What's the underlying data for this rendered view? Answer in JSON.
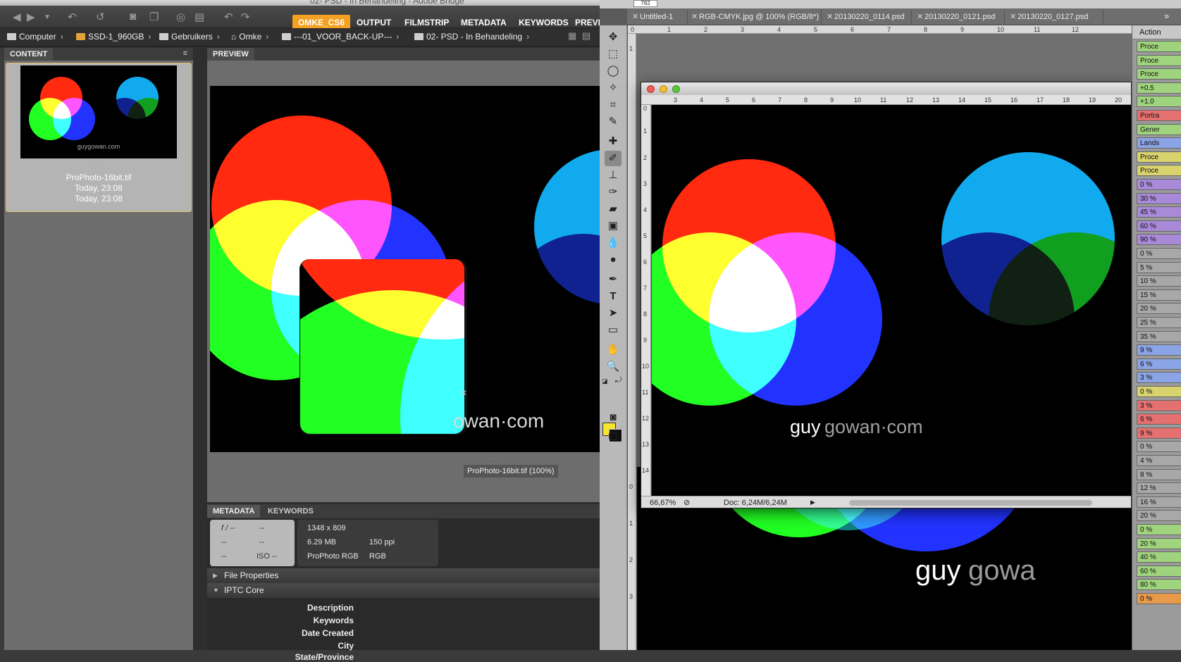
{
  "bridge": {
    "window_title": "02- PSD - In Behandeling - Adobe Bridge",
    "workspaces": [
      "OMKE_CS6",
      "OUTPUT",
      "FILMSTRIP",
      "METADATA",
      "KEYWORDS",
      "PREVI"
    ],
    "breadcrumbs": [
      "Computer",
      "SSD-1_960GB",
      "Gebruikers",
      "Omke",
      "---01_VOOR_BACK-UP---",
      "02- PSD - In Behandeling"
    ],
    "content_tab": "CONTENT",
    "preview_tab": "PREVIEW",
    "thumbnail": {
      "name": "ProPhoto-16bit.tif",
      "date_created": "Today, 23:08",
      "date_modified": "Today, 23:08",
      "logo": "guygowan.com"
    },
    "preview_caption": "ProPhoto-16bit.tif (100%)",
    "preview_logo": "owan·com",
    "metadata_tabs": [
      "METADATA",
      "KEYWORDS"
    ],
    "camera": {
      "fstop": "f / --",
      "shutter": "--",
      "r2a": "--",
      "r2b": "--",
      "r3a": "--",
      "iso": "ISO --"
    },
    "file_info": {
      "dimensions": "1348 x 809",
      "size": "6.29 MB",
      "resolution": "150 ppi",
      "profile": "ProPhoto RGB",
      "mode": "RGB"
    },
    "sections": [
      "File Properties",
      "IPTC Core"
    ],
    "iptc_fields": [
      "Description",
      "Keywords",
      "Date Created",
      "City",
      "State/Province"
    ]
  },
  "photoshop": {
    "options_value": "782",
    "doc_tabs": [
      "Untitled-1",
      "RGB-CMYK.jpg @ 100% (RGB/8*)",
      "20130220_0114.psd",
      "20130220_0121.psd",
      "20130220_0127.psd"
    ],
    "tabs_overflow": "»",
    "window": {
      "logo_left": "guy",
      "logo_right": "gowan·com",
      "zoom": "66,67%",
      "doc_size": "Doc: 6,24M/6,24M"
    },
    "bg_logo_left": "guy",
    "bg_logo_right": "gowa",
    "actions_title": "Action",
    "actions": [
      {
        "label": "Proce",
        "color": "#9fd37d"
      },
      {
        "label": "Proce",
        "color": "#9fd37d"
      },
      {
        "label": "Proce",
        "color": "#9fd37d"
      },
      {
        "label": "+0.5",
        "color": "#9fd37d"
      },
      {
        "label": "+1.0",
        "color": "#9fd37d"
      },
      {
        "label": "Portra",
        "color": "#e4706f"
      },
      {
        "label": "Gener",
        "color": "#9fd37d"
      },
      {
        "label": "Lands",
        "color": "#8aa4e6"
      },
      {
        "label": "Proce",
        "color": "#d9d36e"
      },
      {
        "label": "Proce",
        "color": "#d9d36e"
      },
      {
        "label": "0 %",
        "color": "#a88ad8"
      },
      {
        "label": "30 %",
        "color": "#a88ad8"
      },
      {
        "label": "45 %",
        "color": "#a88ad8"
      },
      {
        "label": "60 %",
        "color": "#a88ad8"
      },
      {
        "label": "90 %",
        "color": "#a88ad8"
      },
      {
        "label": "0 %",
        "color": "#a8a8a8"
      },
      {
        "label": "5 %",
        "color": "#a8a8a8"
      },
      {
        "label": "10 %",
        "color": "#a8a8a8"
      },
      {
        "label": "15 %",
        "color": "#a8a8a8"
      },
      {
        "label": "20 %",
        "color": "#a8a8a8"
      },
      {
        "label": "25 %",
        "color": "#a8a8a8"
      },
      {
        "label": "35 %",
        "color": "#a8a8a8"
      },
      {
        "label": "9 %",
        "color": "#8aa4e6"
      },
      {
        "label": "6 %",
        "color": "#8aa4e6"
      },
      {
        "label": "3 %",
        "color": "#8aa4e6"
      },
      {
        "label": "0 %",
        "color": "#d9d36e"
      },
      {
        "label": "3 %",
        "color": "#e4706f"
      },
      {
        "label": "6 %",
        "color": "#e4706f"
      },
      {
        "label": "9 %",
        "color": "#e4706f"
      },
      {
        "label": "0 %",
        "color": "#a8a8a8"
      },
      {
        "label": "4 %",
        "color": "#a8a8a8"
      },
      {
        "label": "8 %",
        "color": "#a8a8a8"
      },
      {
        "label": "12 %",
        "color": "#a8a8a8"
      },
      {
        "label": "16 %",
        "color": "#a8a8a8"
      },
      {
        "label": "20 %",
        "color": "#a8a8a8"
      },
      {
        "label": "0 %",
        "color": "#9fd37d"
      },
      {
        "label": "20 %",
        "color": "#9fd37d"
      },
      {
        "label": "40 %",
        "color": "#9fd37d"
      },
      {
        "label": "60 %",
        "color": "#9fd37d"
      },
      {
        "label": "80 %",
        "color": "#9fd37d"
      },
      {
        "label": "0 %",
        "color": "#e89a4a"
      }
    ]
  },
  "colors": {
    "bridge_accent": "#f4a020",
    "foreground_color": "#f6e52b"
  }
}
